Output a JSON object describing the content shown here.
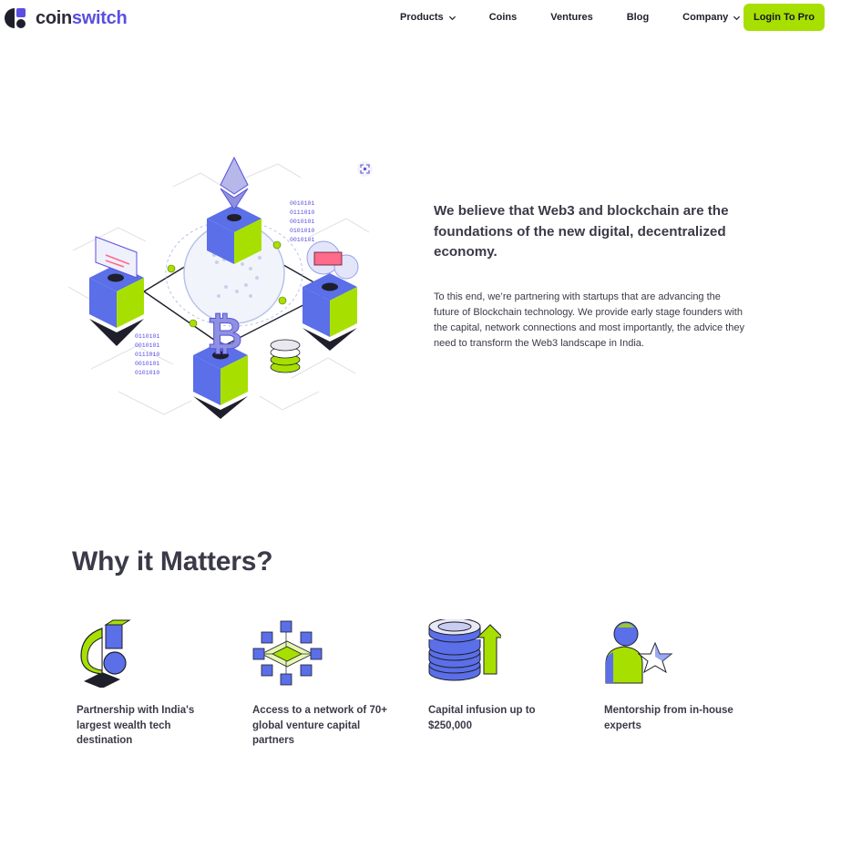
{
  "brand": {
    "name_part1": "coin",
    "name_part2": "switch",
    "accent": "#5a4fe0",
    "lime": "#a7e000"
  },
  "nav": {
    "items": [
      {
        "label": "Products",
        "dropdown": true
      },
      {
        "label": "Coins",
        "dropdown": false
      },
      {
        "label": "Ventures",
        "dropdown": false
      },
      {
        "label": "Blog",
        "dropdown": false
      },
      {
        "label": "Company",
        "dropdown": true
      }
    ],
    "login_label": "Login To Pro"
  },
  "hero": {
    "heading": "We believe that Web3 and blockchain are the foundations of the new digital, decentralized economy.",
    "body": "To this end, we’re partnering with startups that are advancing the future of Blockchain technology. We provide early stage founders with the capital, network connections and most importantly, the advice they need to transform the Web3 landscape in India.",
    "binary_1": "0010101",
    "binary_2": "0111010",
    "binary_3": "0010101",
    "binary_4": "0101010",
    "binary_5": "0010101",
    "binary_6": "0110101"
  },
  "why": {
    "title": "Why it Matters?",
    "features": [
      {
        "label": "Partnership with India's largest wealth tech destination",
        "icon": "partnership-icon"
      },
      {
        "label": "Access to a network of 70+ global venture capital partners",
        "icon": "network-icon"
      },
      {
        "label": "Capital infusion up to $250,000",
        "icon": "capital-icon"
      },
      {
        "label": "Mentorship from in-house experts",
        "icon": "mentorship-icon"
      }
    ]
  }
}
